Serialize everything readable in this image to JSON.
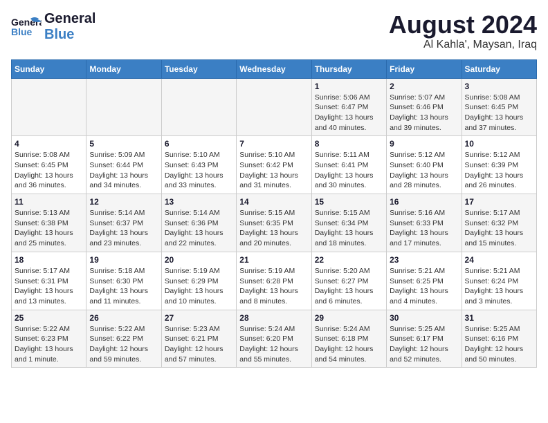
{
  "header": {
    "logo_general": "General",
    "logo_blue": "Blue",
    "month": "August 2024",
    "location": "Al Kahla', Maysan, Iraq"
  },
  "weekdays": [
    "Sunday",
    "Monday",
    "Tuesday",
    "Wednesday",
    "Thursday",
    "Friday",
    "Saturday"
  ],
  "weeks": [
    [
      {
        "day": "",
        "info": ""
      },
      {
        "day": "",
        "info": ""
      },
      {
        "day": "",
        "info": ""
      },
      {
        "day": "",
        "info": ""
      },
      {
        "day": "1",
        "info": "Sunrise: 5:06 AM\nSunset: 6:47 PM\nDaylight: 13 hours\nand 40 minutes."
      },
      {
        "day": "2",
        "info": "Sunrise: 5:07 AM\nSunset: 6:46 PM\nDaylight: 13 hours\nand 39 minutes."
      },
      {
        "day": "3",
        "info": "Sunrise: 5:08 AM\nSunset: 6:45 PM\nDaylight: 13 hours\nand 37 minutes."
      }
    ],
    [
      {
        "day": "4",
        "info": "Sunrise: 5:08 AM\nSunset: 6:45 PM\nDaylight: 13 hours\nand 36 minutes."
      },
      {
        "day": "5",
        "info": "Sunrise: 5:09 AM\nSunset: 6:44 PM\nDaylight: 13 hours\nand 34 minutes."
      },
      {
        "day": "6",
        "info": "Sunrise: 5:10 AM\nSunset: 6:43 PM\nDaylight: 13 hours\nand 33 minutes."
      },
      {
        "day": "7",
        "info": "Sunrise: 5:10 AM\nSunset: 6:42 PM\nDaylight: 13 hours\nand 31 minutes."
      },
      {
        "day": "8",
        "info": "Sunrise: 5:11 AM\nSunset: 6:41 PM\nDaylight: 13 hours\nand 30 minutes."
      },
      {
        "day": "9",
        "info": "Sunrise: 5:12 AM\nSunset: 6:40 PM\nDaylight: 13 hours\nand 28 minutes."
      },
      {
        "day": "10",
        "info": "Sunrise: 5:12 AM\nSunset: 6:39 PM\nDaylight: 13 hours\nand 26 minutes."
      }
    ],
    [
      {
        "day": "11",
        "info": "Sunrise: 5:13 AM\nSunset: 6:38 PM\nDaylight: 13 hours\nand 25 minutes."
      },
      {
        "day": "12",
        "info": "Sunrise: 5:14 AM\nSunset: 6:37 PM\nDaylight: 13 hours\nand 23 minutes."
      },
      {
        "day": "13",
        "info": "Sunrise: 5:14 AM\nSunset: 6:36 PM\nDaylight: 13 hours\nand 22 minutes."
      },
      {
        "day": "14",
        "info": "Sunrise: 5:15 AM\nSunset: 6:35 PM\nDaylight: 13 hours\nand 20 minutes."
      },
      {
        "day": "15",
        "info": "Sunrise: 5:15 AM\nSunset: 6:34 PM\nDaylight: 13 hours\nand 18 minutes."
      },
      {
        "day": "16",
        "info": "Sunrise: 5:16 AM\nSunset: 6:33 PM\nDaylight: 13 hours\nand 17 minutes."
      },
      {
        "day": "17",
        "info": "Sunrise: 5:17 AM\nSunset: 6:32 PM\nDaylight: 13 hours\nand 15 minutes."
      }
    ],
    [
      {
        "day": "18",
        "info": "Sunrise: 5:17 AM\nSunset: 6:31 PM\nDaylight: 13 hours\nand 13 minutes."
      },
      {
        "day": "19",
        "info": "Sunrise: 5:18 AM\nSunset: 6:30 PM\nDaylight: 13 hours\nand 11 minutes."
      },
      {
        "day": "20",
        "info": "Sunrise: 5:19 AM\nSunset: 6:29 PM\nDaylight: 13 hours\nand 10 minutes."
      },
      {
        "day": "21",
        "info": "Sunrise: 5:19 AM\nSunset: 6:28 PM\nDaylight: 13 hours\nand 8 minutes."
      },
      {
        "day": "22",
        "info": "Sunrise: 5:20 AM\nSunset: 6:27 PM\nDaylight: 13 hours\nand 6 minutes."
      },
      {
        "day": "23",
        "info": "Sunrise: 5:21 AM\nSunset: 6:25 PM\nDaylight: 13 hours\nand 4 minutes."
      },
      {
        "day": "24",
        "info": "Sunrise: 5:21 AM\nSunset: 6:24 PM\nDaylight: 13 hours\nand 3 minutes."
      }
    ],
    [
      {
        "day": "25",
        "info": "Sunrise: 5:22 AM\nSunset: 6:23 PM\nDaylight: 13 hours\nand 1 minute."
      },
      {
        "day": "26",
        "info": "Sunrise: 5:22 AM\nSunset: 6:22 PM\nDaylight: 12 hours\nand 59 minutes."
      },
      {
        "day": "27",
        "info": "Sunrise: 5:23 AM\nSunset: 6:21 PM\nDaylight: 12 hours\nand 57 minutes."
      },
      {
        "day": "28",
        "info": "Sunrise: 5:24 AM\nSunset: 6:20 PM\nDaylight: 12 hours\nand 55 minutes."
      },
      {
        "day": "29",
        "info": "Sunrise: 5:24 AM\nSunset: 6:18 PM\nDaylight: 12 hours\nand 54 minutes."
      },
      {
        "day": "30",
        "info": "Sunrise: 5:25 AM\nSunset: 6:17 PM\nDaylight: 12 hours\nand 52 minutes."
      },
      {
        "day": "31",
        "info": "Sunrise: 5:25 AM\nSunset: 6:16 PM\nDaylight: 12 hours\nand 50 minutes."
      }
    ]
  ]
}
